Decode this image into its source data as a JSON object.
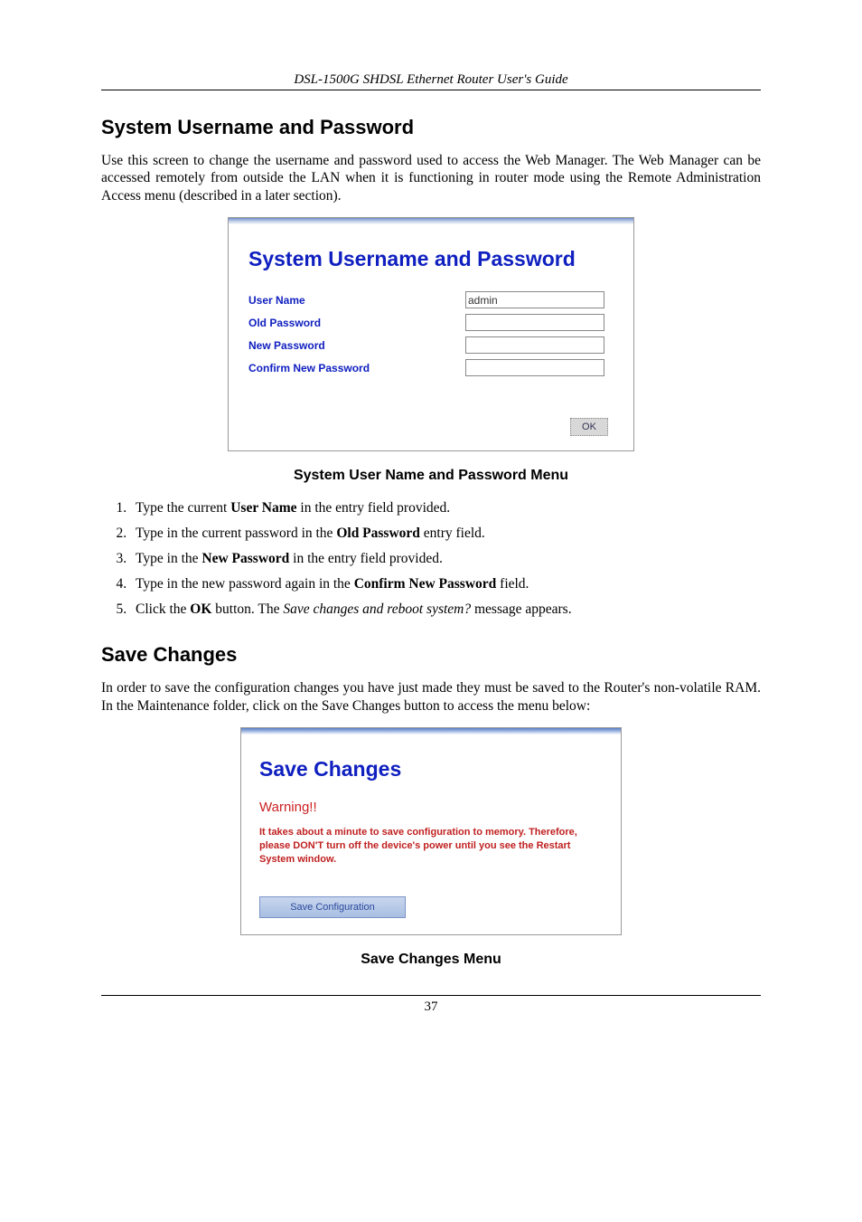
{
  "header": {
    "running_title": "DSL-1500G SHDSL Ethernet Router User's Guide"
  },
  "section1": {
    "heading": "System Username and Password",
    "intro": "Use this screen to change the username and password used to access the Web Manager. The Web Manager can be accessed remotely from outside the LAN when it is functioning in router mode using the Remote Administration Access menu (described in a later section)."
  },
  "panel1": {
    "title": "System Username and Password",
    "fields": {
      "username_label": "User Name",
      "username_value": "admin",
      "oldpw_label": "Old Password",
      "oldpw_value": "",
      "newpw_label": "New Password",
      "newpw_value": "",
      "confirmpw_label": "Confirm New Password",
      "confirmpw_value": ""
    },
    "ok_label": "OK"
  },
  "caption1": "System User Name and Password Menu",
  "steps": {
    "s1a": "Type the current ",
    "s1b": "User Name",
    "s1c": " in the entry field provided.",
    "s2a": "Type in the current password in the ",
    "s2b": "Old Password",
    "s2c": " entry field.",
    "s3a": "Type in the ",
    "s3b": "New Password",
    "s3c": " in the entry field provided.",
    "s4a": "Type in the new password again in the ",
    "s4b": "Confirm New Password",
    "s4c": " field.",
    "s5a": "Click the ",
    "s5b": "OK",
    "s5c": " button. The ",
    "s5d": "Save changes and reboot system?",
    "s5e": " message appears."
  },
  "section2": {
    "heading": "Save Changes",
    "intro": "In order to save the configuration changes you have just made they must be saved to the Router's non-volatile RAM. In the Maintenance folder, click on the Save Changes button to access the menu below:"
  },
  "panel2": {
    "title": "Save Changes",
    "warn_heading": "Warning!!",
    "warn_body": "It takes about a minute to save configuration to memory. Therefore, please DON'T turn off the device's power until you see the Restart System window.",
    "save_label": "Save Configuration"
  },
  "caption2": "Save Changes Menu",
  "footer": {
    "page_number": "37"
  }
}
